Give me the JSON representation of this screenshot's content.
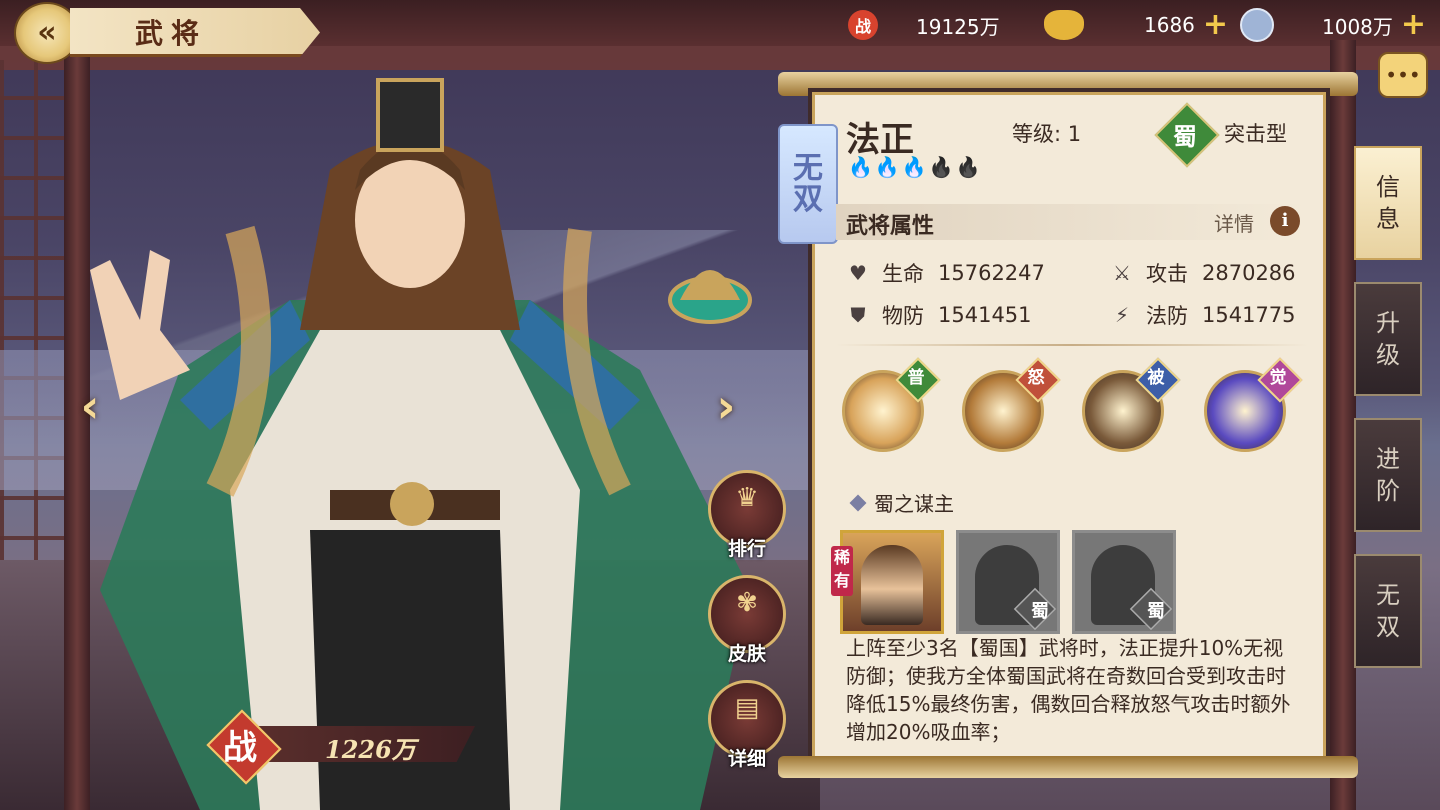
{
  "header": {
    "back_icon": "back-arrow-icon",
    "title": "武将"
  },
  "resources": [
    {
      "icon": "battle-power-icon",
      "glyph": "战",
      "value": "19125万",
      "has_plus": false,
      "color": "#d8432e"
    },
    {
      "icon": "gold-ingot-icon",
      "glyph": "",
      "value": "1686",
      "has_plus": true,
      "color": "#e5b43a"
    },
    {
      "icon": "silver-coin-icon",
      "glyph": "",
      "value": "1008万",
      "has_plus": true,
      "color": "#9fb4d6"
    }
  ],
  "hero": {
    "name": "法正",
    "level_label": "等级: 1",
    "faction": "蜀",
    "type": "突击型",
    "wushuang_tag": [
      "无",
      "双"
    ],
    "stars_lit": 3,
    "stars_total": 5,
    "power_seal": "战",
    "power_value": "1226万"
  },
  "side_buttons": [
    {
      "label": "排行",
      "icon": "ranking-icon"
    },
    {
      "label": "皮肤",
      "icon": "skin-icon"
    },
    {
      "label": "详细",
      "icon": "book-icon"
    }
  ],
  "attributes": {
    "section_title": "武将属性",
    "details_label": "详情",
    "info_glyph": "i",
    "items": [
      {
        "icon": "heart-icon",
        "glyph": "♥",
        "label": "生命",
        "value": "15762247"
      },
      {
        "icon": "sword-icon",
        "glyph": "⚔",
        "label": "攻击",
        "value": "2870286"
      },
      {
        "icon": "shield-icon",
        "glyph": "⛊",
        "label": "物防",
        "value": "1541451"
      },
      {
        "icon": "magic-shield-icon",
        "glyph": "⚡",
        "label": "法防",
        "value": "1541775"
      }
    ]
  },
  "skills": [
    {
      "tag": "普",
      "tag_color": "#3f8a3a",
      "icon": "normal-attack-skill-icon",
      "bg": "#d8a35a"
    },
    {
      "tag": "怒",
      "tag_color": "#c0503a",
      "icon": "rage-skill-icon",
      "bg": "#b37b3a"
    },
    {
      "tag": "被",
      "tag_color": "#3d5ea8",
      "icon": "passive-skill-icon",
      "bg": "#7a5a3a"
    },
    {
      "tag": "觉",
      "tag_color": "#b0489a",
      "icon": "awaken-skill-icon",
      "bg": "#5a4ac0"
    }
  ],
  "combo": {
    "title": "蜀之谋主",
    "rare_label": "稀有",
    "cards": [
      {
        "owned": true,
        "badge": ""
      },
      {
        "owned": false,
        "badge": "蜀"
      },
      {
        "owned": false,
        "badge": "蜀"
      }
    ],
    "description": "上阵至少3名【蜀国】武将时，法正提升10%无视防御；使我方全体蜀国武将在奇数回合受到攻击时降低15%最终伤害，偶数回合释放怒气攻击时额外增加20%吸血率；"
  },
  "tabs": [
    {
      "label": [
        "信",
        "息"
      ],
      "active": true
    },
    {
      "label": [
        "升",
        "级"
      ],
      "active": false
    },
    {
      "label": [
        "进",
        "阶"
      ],
      "active": false
    },
    {
      "label": [
        "无",
        "双"
      ],
      "active": false
    }
  ],
  "chat_icon": "chat-bubble-icon"
}
